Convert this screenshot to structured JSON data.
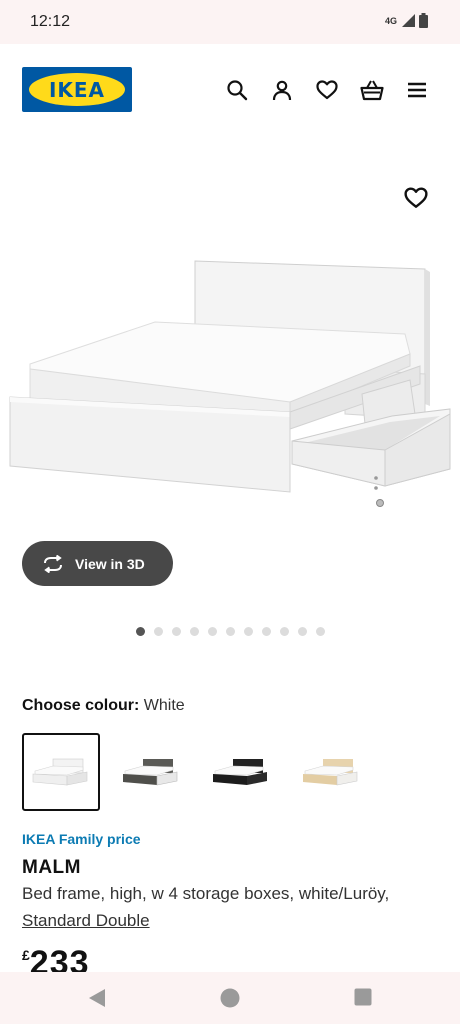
{
  "status": {
    "time": "12:12",
    "network": "4G"
  },
  "header": {
    "logo_text": "IKEA",
    "icons": [
      "search-icon",
      "person-icon",
      "heart-icon",
      "basket-icon",
      "menu-icon"
    ]
  },
  "gallery": {
    "view3d_label": "View in 3D",
    "image_count": 11,
    "active_index": 0
  },
  "colour": {
    "label": "Choose colour:",
    "selected": "White",
    "options": [
      "white",
      "black-brown",
      "black",
      "oak"
    ]
  },
  "product": {
    "family_price_label": "IKEA Family price",
    "name": "MALM",
    "description": "Bed frame, high, w 4 storage boxes, white/Luröy,",
    "size": "Standard Double",
    "currency": "£",
    "price": "233"
  },
  "colors": {
    "brand_blue": "#0058a3",
    "brand_yellow": "#ffda1a",
    "family_blue": "#0c7bb3",
    "button_dark": "#484848"
  }
}
